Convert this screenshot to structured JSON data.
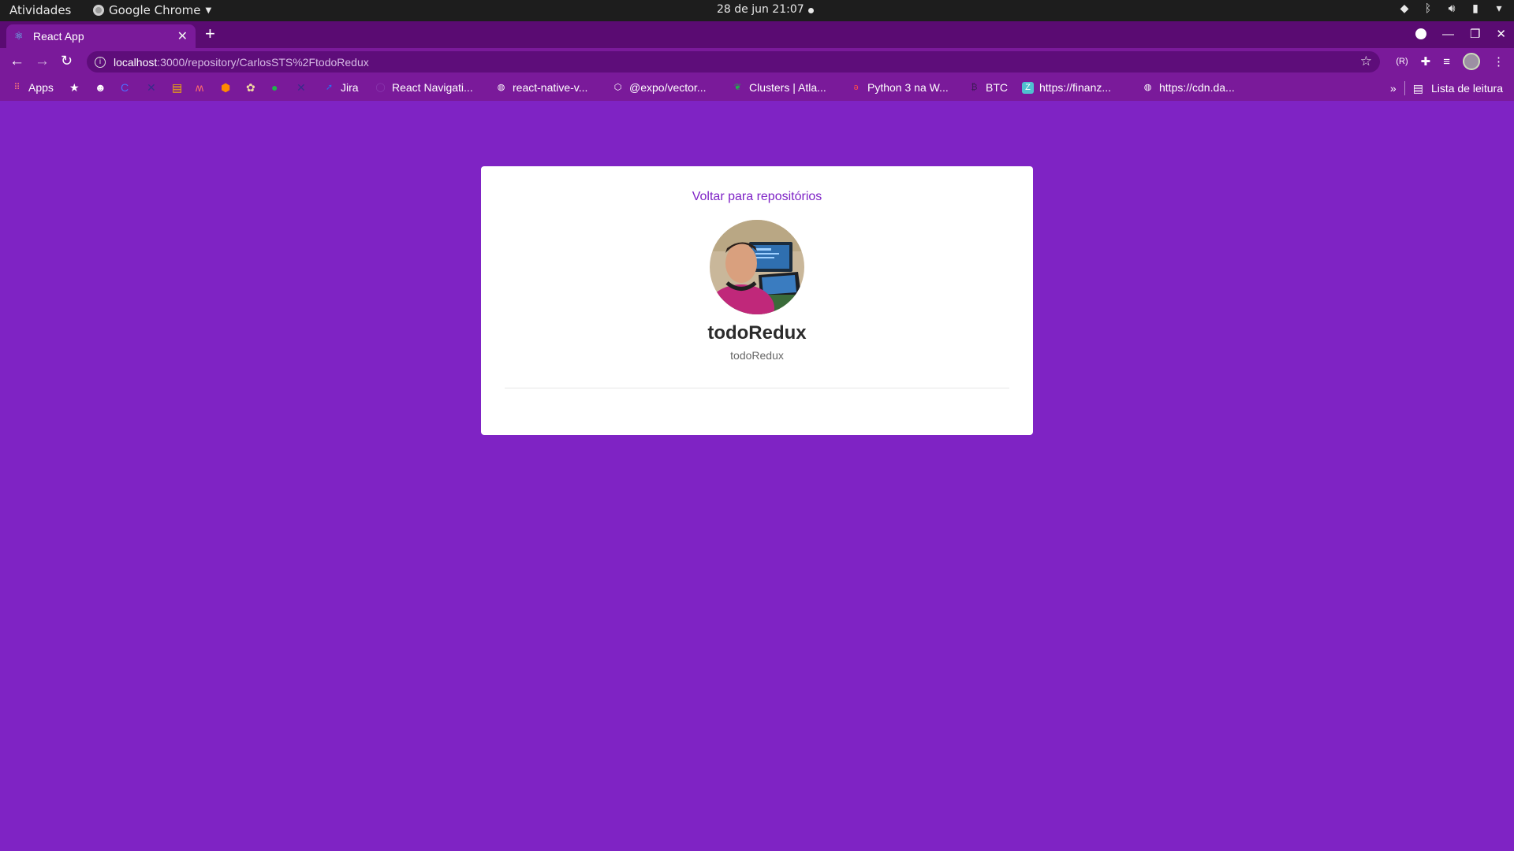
{
  "os": {
    "activities": "Atividades",
    "app_name": "Google Chrome",
    "clock": "28 de jun  21:07"
  },
  "browser": {
    "tab_title": "React App",
    "url_host": "localhost",
    "url_path": ":3000/repository/CarlosSTS%2FtodoRedux",
    "bookmarks": [
      {
        "label": "Apps",
        "icon": "apps-grid-icon"
      },
      {
        "label": "Jira",
        "icon": "jira-icon"
      },
      {
        "label": "React Navigati...",
        "icon": "react-navigation-icon"
      },
      {
        "label": "react-native-v...",
        "icon": "globe-icon"
      },
      {
        "label": "@expo/vector...",
        "icon": "expo-icon"
      },
      {
        "label": "Clusters | Atla...",
        "icon": "mongodb-leaf-icon"
      },
      {
        "label": "Python 3 na W...",
        "icon": "python-icon"
      },
      {
        "label": "BTC",
        "icon": "bitcoin-icon"
      },
      {
        "label": "https://finanz...",
        "icon": "finance-icon"
      },
      {
        "label": "https://cdn.da...",
        "icon": "globe-icon"
      }
    ],
    "reading_list": "Lista de leitura",
    "more_bookmarks": "»"
  },
  "page": {
    "back_link": "Voltar para repositórios",
    "repo_name": "todoRedux",
    "repo_description": "todoRedux"
  },
  "colors": {
    "page_background": "#7f23c4",
    "accent": "#7e22c6",
    "card": "#ffffff"
  }
}
